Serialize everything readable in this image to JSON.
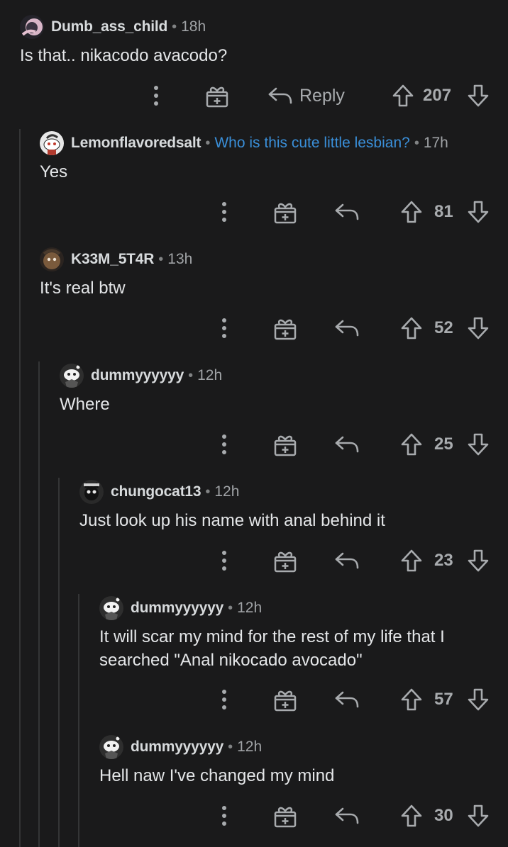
{
  "comments": [
    {
      "user": "Dumb_ass_child",
      "flair": "",
      "time": "18h",
      "text": "Is that.. nikacodo avacodo?",
      "reply_label": "Reply",
      "score": "207",
      "avatar": "pink-avatar"
    },
    {
      "user": "Lemonflavoredsalt",
      "flair": "Who is this cute little lesbian?",
      "time": "17h",
      "text": "Yes",
      "score": "81",
      "avatar": "snoo-avatar"
    },
    {
      "user": "K33M_5T4R",
      "flair": "",
      "time": "13h",
      "text": "It's real btw",
      "score": "52",
      "avatar": "brown-avatar"
    },
    {
      "user": "dummyyyyyy",
      "flair": "",
      "time": "12h",
      "text": "Where",
      "score": "25",
      "avatar": "snoo-avatar"
    },
    {
      "user": "chungocat13",
      "flair": "",
      "time": "12h",
      "text": "Just look up his name with anal behind it",
      "score": "23",
      "avatar": "cat-avatar"
    },
    {
      "user": "dummyyyyyy",
      "flair": "",
      "time": "12h",
      "text_lines": [
        "It will scar my mind for the rest of my life that I",
        "searched \"Anal nikocado avocado\""
      ],
      "score": "57",
      "avatar": "snoo-avatar"
    },
    {
      "user": "dummyyyyyy",
      "flair": "",
      "time": "12h",
      "text": "Hell naw I've changed my mind",
      "score": "30",
      "avatar": "snoo-avatar"
    }
  ],
  "colors": {
    "background": "#1a1a1b",
    "text": "#d7dadc",
    "flair": "#3a8fd9",
    "meta": "#a0a3a6",
    "thread_line": "#343536"
  }
}
